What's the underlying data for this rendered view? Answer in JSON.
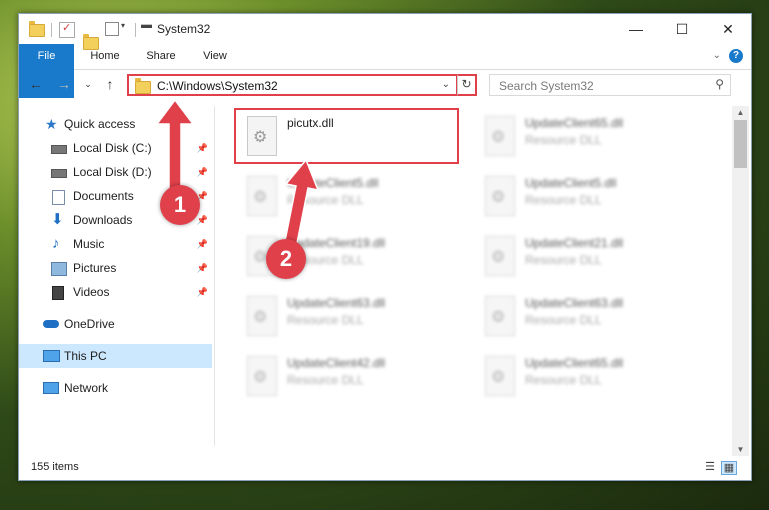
{
  "window": {
    "title": "System32",
    "minimize_icon": "minimize-icon",
    "maximize_icon": "maximize-icon",
    "close_icon": "close-icon"
  },
  "ribbon": {
    "tabs": [
      "File",
      "Home",
      "Share",
      "View"
    ],
    "help": "?"
  },
  "address": {
    "path": "C:\\Windows\\System32",
    "search_placeholder": "Search System32"
  },
  "sidebar": {
    "items": [
      {
        "label": "Quick access",
        "icon": "star-icon"
      },
      {
        "label": "Local Disk (C:)",
        "icon": "drive-icon",
        "pinned": true
      },
      {
        "label": "Local Disk (D:)",
        "icon": "drive-icon",
        "pinned": true
      },
      {
        "label": "Documents",
        "icon": "documents-icon",
        "pinned": true
      },
      {
        "label": "Downloads",
        "icon": "download-icon",
        "pinned": true
      },
      {
        "label": "Music",
        "icon": "music-icon",
        "pinned": true
      },
      {
        "label": "Pictures",
        "icon": "pictures-icon",
        "pinned": true
      },
      {
        "label": "Videos",
        "icon": "videos-icon",
        "pinned": true
      },
      {
        "label": "OneDrive",
        "icon": "cloud-icon"
      },
      {
        "label": "This PC",
        "icon": "computer-icon",
        "selected": true
      },
      {
        "label": "Network",
        "icon": "network-icon"
      }
    ]
  },
  "files": [
    {
      "name": "picutx.dll",
      "type": "",
      "highlighted": true
    },
    {
      "name": "UpdateClient65.dll",
      "type": "Resource DLL"
    },
    {
      "name": "UpdateClient5.dll",
      "type": "Resource DLL"
    },
    {
      "name": "UpdateClient5.dll",
      "type": "Resource DLL"
    },
    {
      "name": "UpdateClient19.dll",
      "type": "Resource DLL"
    },
    {
      "name": "UpdateClient21.dll",
      "type": "Resource DLL"
    },
    {
      "name": "UpdateClient63.dll",
      "type": "Resource DLL"
    },
    {
      "name": "UpdateClient63.dll",
      "type": "Resource DLL"
    },
    {
      "name": "UpdateClient42.dll",
      "type": "Resource DLL"
    },
    {
      "name": "UpdateClient65.dll",
      "type": "Resource DLL"
    }
  ],
  "status": {
    "item_count": "155 items"
  },
  "annotations": {
    "step1": "1",
    "step2": "2",
    "color": "#e0404a"
  }
}
